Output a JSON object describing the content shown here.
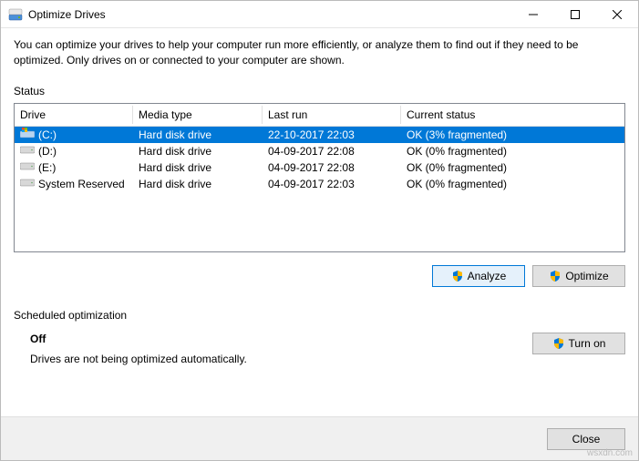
{
  "window": {
    "title": "Optimize Drives"
  },
  "intro": "You can optimize your drives to help your computer run more efficiently, or analyze them to find out if they need to be optimized. Only drives on or connected to your computer are shown.",
  "status_label": "Status",
  "columns": {
    "drive": "Drive",
    "media": "Media type",
    "last": "Last run",
    "status": "Current status"
  },
  "rows": [
    {
      "name": "(C:)",
      "media": "Hard disk drive",
      "last": "22-10-2017 22:03",
      "status": "OK (3% fragmented)",
      "selected": true,
      "icon": "os"
    },
    {
      "name": "(D:)",
      "media": "Hard disk drive",
      "last": "04-09-2017 22:08",
      "status": "OK (0% fragmented)",
      "selected": false,
      "icon": "hdd"
    },
    {
      "name": "(E:)",
      "media": "Hard disk drive",
      "last": "04-09-2017 22:08",
      "status": "OK (0% fragmented)",
      "selected": false,
      "icon": "hdd"
    },
    {
      "name": "System Reserved",
      "media": "Hard disk drive",
      "last": "04-09-2017 22:03",
      "status": "OK (0% fragmented)",
      "selected": false,
      "icon": "hdd"
    }
  ],
  "buttons": {
    "analyze": "Analyze",
    "optimize": "Optimize",
    "turn_on": "Turn on",
    "close": "Close"
  },
  "scheduled": {
    "label": "Scheduled optimization",
    "state": "Off",
    "desc": "Drives are not being optimized automatically."
  },
  "watermark": "wsxdn.com",
  "colors": {
    "selection": "#0078d7",
    "button_face": "#e1e1e1",
    "focus_border": "#0078d7",
    "focus_bg": "#e5f1fb"
  }
}
